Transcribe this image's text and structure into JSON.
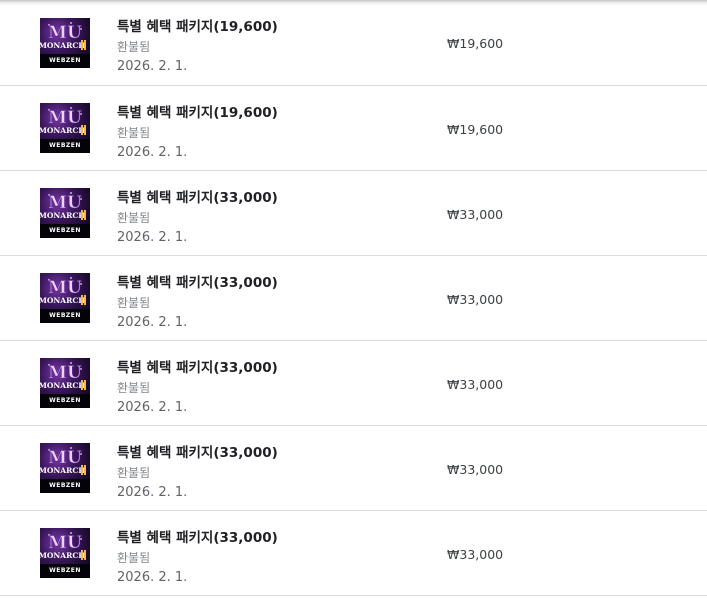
{
  "purchases": [
    {
      "icon": "mu-monarch-game-icon",
      "brand": "WEBZEN",
      "logo_text": "MU",
      "logo_sub": "MONARCH",
      "title": "특별 혜택 패키지(19,600)",
      "status": "환불됨",
      "date": "2026. 2. 1.",
      "price": "₩19,600"
    },
    {
      "icon": "mu-monarch-game-icon",
      "brand": "WEBZEN",
      "logo_text": "MU",
      "logo_sub": "MONARCH",
      "title": "특별 혜택 패키지(19,600)",
      "status": "환불됨",
      "date": "2026. 2. 1.",
      "price": "₩19,600"
    },
    {
      "icon": "mu-monarch-game-icon",
      "brand": "WEBZEN",
      "logo_text": "MU",
      "logo_sub": "MONARCH",
      "title": "특별 혜택 패키지(33,000)",
      "status": "환불됨",
      "date": "2026. 2. 1.",
      "price": "₩33,000"
    },
    {
      "icon": "mu-monarch-game-icon",
      "brand": "WEBZEN",
      "logo_text": "MU",
      "logo_sub": "MONARCH",
      "title": "특별 혜택 패키지(33,000)",
      "status": "환불됨",
      "date": "2026. 2. 1.",
      "price": "₩33,000"
    },
    {
      "icon": "mu-monarch-game-icon",
      "brand": "WEBZEN",
      "logo_text": "MU",
      "logo_sub": "MONARCH",
      "title": "특별 혜택 패키지(33,000)",
      "status": "환불됨",
      "date": "2026. 2. 1.",
      "price": "₩33,000"
    },
    {
      "icon": "mu-monarch-game-icon",
      "brand": "WEBZEN",
      "logo_text": "MU",
      "logo_sub": "MONARCH",
      "title": "특별 혜택 패키지(33,000)",
      "status": "환불됨",
      "date": "2026. 2. 1.",
      "price": "₩33,000"
    },
    {
      "icon": "mu-monarch-game-icon",
      "brand": "WEBZEN",
      "logo_text": "MU",
      "logo_sub": "MONARCH",
      "title": "특별 혜택 패키지(33,000)",
      "status": "환불됨",
      "date": "2026. 2. 1.",
      "price": "₩33,000"
    }
  ],
  "colors": {
    "title": "#202124",
    "status": "#80868b",
    "date": "#5f6368",
    "price": "#3c4043",
    "divider": "#dadce0"
  }
}
